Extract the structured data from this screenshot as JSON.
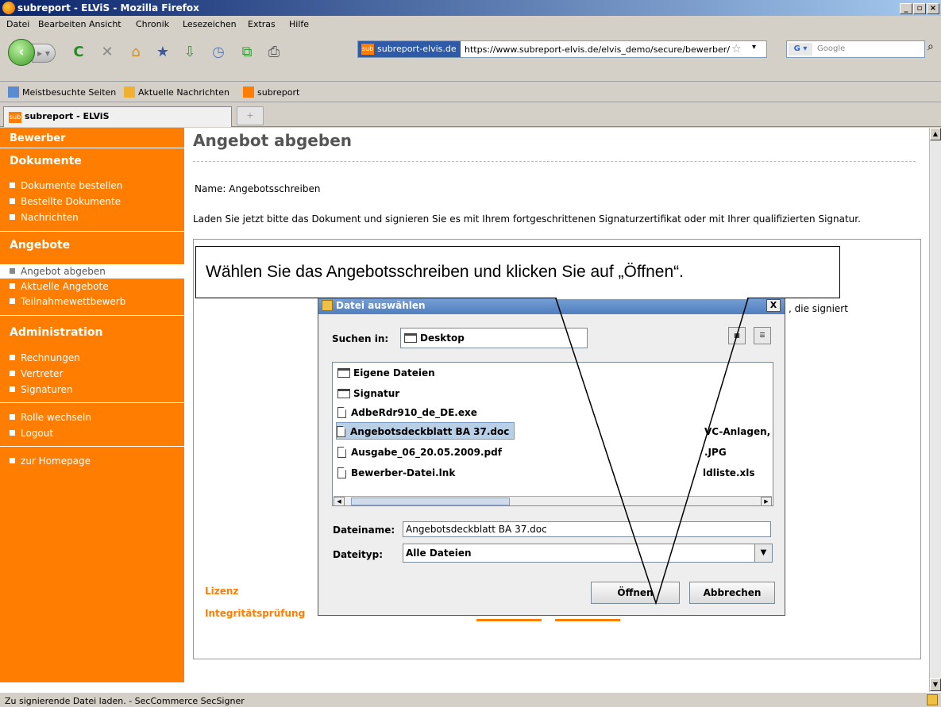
{
  "window": {
    "title": "subreport - ELViS - Mozilla Firefox"
  },
  "menu": [
    "Datei",
    "Bearbeiten",
    "Ansicht",
    "Chronik",
    "Lesezeichen",
    "Extras",
    "Hilfe"
  ],
  "urlbar": {
    "site": "subreport-elvis.de",
    "url": "https://www.subreport-elvis.de/elvis_demo/secure/bewerber/"
  },
  "search": {
    "placeholder": "Google"
  },
  "bookmarks": [
    "Meistbesuchte Seiten",
    "Aktuelle Nachrichten",
    "subreport"
  ],
  "tab": {
    "title": "subreport - ELViS"
  },
  "sidebar": {
    "header": "Bewerber",
    "sections": {
      "dokumente": "Dokumente",
      "angebote": "Angebote",
      "administration": "Administration"
    },
    "links": {
      "dokumente_bestellen": "Dokumente bestellen",
      "bestellte_dokumente": "Bestellte Dokumente",
      "nachrichten": "Nachrichten",
      "angebot_abgeben": "Angebot abgeben",
      "aktuelle_angebote": "Aktuelle Angebote",
      "teilnahmewettbewerb": "Teilnahmewettbewerb",
      "rechnungen": "Rechnungen",
      "vertreter": "Vertreter",
      "signaturen": "Signaturen",
      "rolle_wechseln": "Rolle wechseln",
      "logout": "Logout",
      "zur_homepage": "zur Homepage"
    }
  },
  "main": {
    "title": "Angebot abgeben",
    "name_line": "Name: Angebotsschreiben",
    "instruction": "Laden Sie jetzt bitte das Dokument und signieren Sie es mit Ihrem fortgeschrittenen Signaturzertifikat oder mit Ihrer qualifizierten Signatur.",
    "panel_text": ", die signiert",
    "lizenz": "Lizenz",
    "integritaet": "Integritätsprüfung"
  },
  "callout": {
    "text": "Wählen Sie das Angebotsschreiben und klicken Sie auf „Öffnen“."
  },
  "dialog": {
    "title": "Datei auswählen",
    "close": "X",
    "look_in_label": "Suchen in:",
    "look_in_value": "Desktop",
    "files": [
      "Eigene Dateien",
      "Signatur",
      "AdbeRdr910_de_DE.exe",
      "Angebotsdeckblatt BA 37.doc",
      "Ausgabe_06_20.05.2009.pdf",
      "Bewerber-Datei.lnk"
    ],
    "files_right": [
      "VC-Anlagen, ",
      ".JPG",
      "ldliste.xls"
    ],
    "filename_label": "Dateiname:",
    "filename_value": "Angebotsdeckblatt BA 37.doc",
    "filetype_label": "Dateityp:",
    "filetype_value": "Alle Dateien",
    "open_button": "Öffnen",
    "cancel_button": "Abbrechen"
  },
  "status": {
    "text": "Zu signierende Datei laden. - SecCommerce SecSigner"
  }
}
